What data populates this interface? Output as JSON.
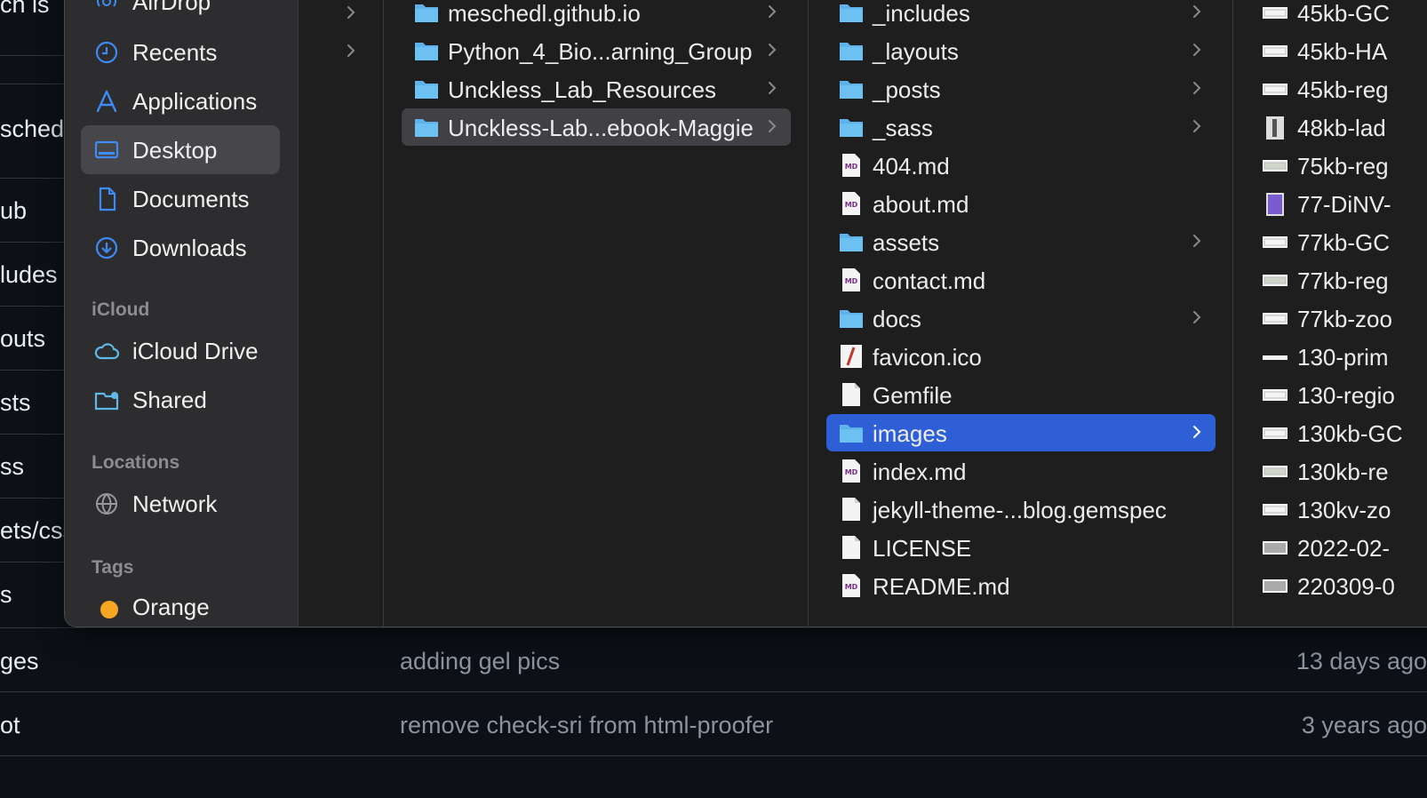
{
  "background": {
    "left_fragments": [
      "ch is",
      "sched",
      "ub",
      "ludes",
      "outs",
      "sts",
      "ss",
      "ets/css",
      "s"
    ],
    "rows": [
      {
        "name": "ges",
        "message": "adding gel pics",
        "age": "13 days ago"
      },
      {
        "name": "ot",
        "message": "remove check-sri from html-proofer",
        "age": "3 years ago"
      }
    ]
  },
  "sidebar": {
    "items_top": [
      {
        "label": "AirDrop",
        "icon": "airdrop-icon"
      },
      {
        "label": "Recents",
        "icon": "clock-icon"
      },
      {
        "label": "Applications",
        "icon": "applications-icon"
      },
      {
        "label": "Desktop",
        "icon": "desktop-icon",
        "selected": true
      },
      {
        "label": "Documents",
        "icon": "document-icon"
      },
      {
        "label": "Downloads",
        "icon": "download-icon"
      }
    ],
    "icloud_heading": "iCloud",
    "icloud_items": [
      {
        "label": "iCloud Drive",
        "icon": "cloud-icon"
      },
      {
        "label": "Shared",
        "icon": "shared-folder-icon"
      }
    ],
    "locations_heading": "Locations",
    "location_items": [
      {
        "label": "Network",
        "icon": "globe-icon"
      }
    ],
    "tags_heading": "Tags",
    "tag_items": [
      {
        "label": "Orange",
        "color": "#f5a623"
      }
    ]
  },
  "column2": {
    "items": [
      {
        "label": "meschedl.github.io",
        "kind": "folder"
      },
      {
        "label": "Python_4_Bio...arning_Group",
        "kind": "folder"
      },
      {
        "label": "Unckless_Lab_Resources",
        "kind": "folder"
      },
      {
        "label": "Unckless-Lab...ebook-Maggie",
        "kind": "folder",
        "selected": true
      }
    ]
  },
  "column3": {
    "items": [
      {
        "label": "_includes",
        "kind": "folder"
      },
      {
        "label": "_layouts",
        "kind": "folder"
      },
      {
        "label": "_posts",
        "kind": "folder"
      },
      {
        "label": "_sass",
        "kind": "folder"
      },
      {
        "label": "404.md",
        "kind": "md"
      },
      {
        "label": "about.md",
        "kind": "md"
      },
      {
        "label": "assets",
        "kind": "folder"
      },
      {
        "label": "contact.md",
        "kind": "md"
      },
      {
        "label": "docs",
        "kind": "folder"
      },
      {
        "label": "favicon.ico",
        "kind": "ico"
      },
      {
        "label": "Gemfile",
        "kind": "file"
      },
      {
        "label": "images",
        "kind": "folder",
        "selected": true
      },
      {
        "label": "index.md",
        "kind": "md"
      },
      {
        "label": "jekyll-theme-...blog.gemspec",
        "kind": "file"
      },
      {
        "label": "LICENSE",
        "kind": "file"
      },
      {
        "label": "README.md",
        "kind": "md"
      }
    ]
  },
  "column4": {
    "items": [
      {
        "label": "45kb-GC",
        "kind": "gel"
      },
      {
        "label": "45kb-HA",
        "kind": "gel"
      },
      {
        "label": "45kb-reg",
        "kind": "gel"
      },
      {
        "label": "48kb-lad",
        "kind": "ladder"
      },
      {
        "label": "75kb-reg",
        "kind": "gel-light"
      },
      {
        "label": "77-DiNV-",
        "kind": "purple"
      },
      {
        "label": "77kb-GC",
        "kind": "gel"
      },
      {
        "label": "77kb-reg",
        "kind": "gel-light"
      },
      {
        "label": "77kb-zoo",
        "kind": "gel"
      },
      {
        "label": "130-prim",
        "kind": "thin"
      },
      {
        "label": "130-regio",
        "kind": "gel"
      },
      {
        "label": "130kb-GC",
        "kind": "gel"
      },
      {
        "label": "130kb-re",
        "kind": "gel-light"
      },
      {
        "label": "130kv-zo",
        "kind": "gel"
      },
      {
        "label": "2022-02-",
        "kind": "gray"
      },
      {
        "label": "220309-0",
        "kind": "gray"
      }
    ]
  },
  "colors": {
    "accent": "#2f5fd6",
    "folder": "#5fb1ea",
    "sidebar_icon": "#3d8cf5"
  }
}
